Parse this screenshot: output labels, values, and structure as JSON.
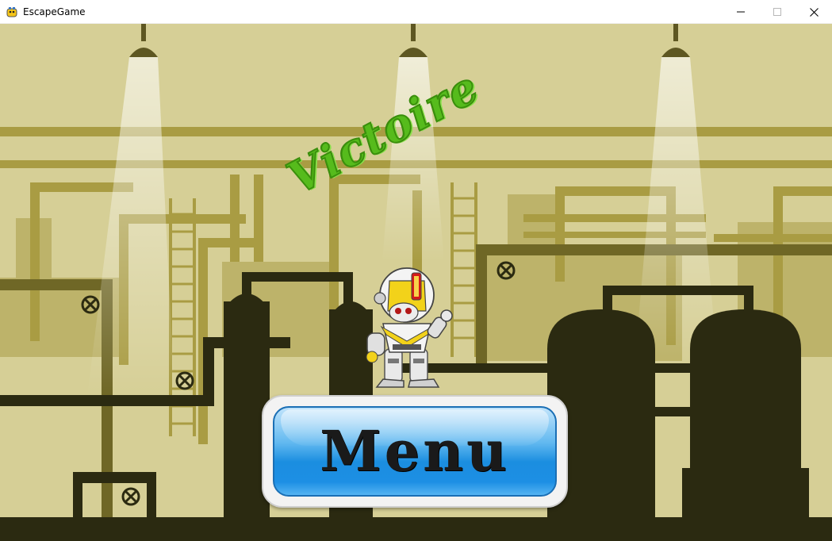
{
  "window": {
    "title": "EscapeGame",
    "app_icon": "pygame-snake-icon",
    "controls": [
      "minimize-icon",
      "maximize-icon",
      "close-icon"
    ]
  },
  "game": {
    "victory_text": "Victoire",
    "menu_button_label": "Menu",
    "character": "yellow-white-robot",
    "background": "industrial-factory-pipes",
    "colors": {
      "background": "#d6cf96",
      "victory_text": "#56bb1c",
      "button_blue": "#1d8fe4",
      "silhouette": "#2b2a11"
    }
  }
}
